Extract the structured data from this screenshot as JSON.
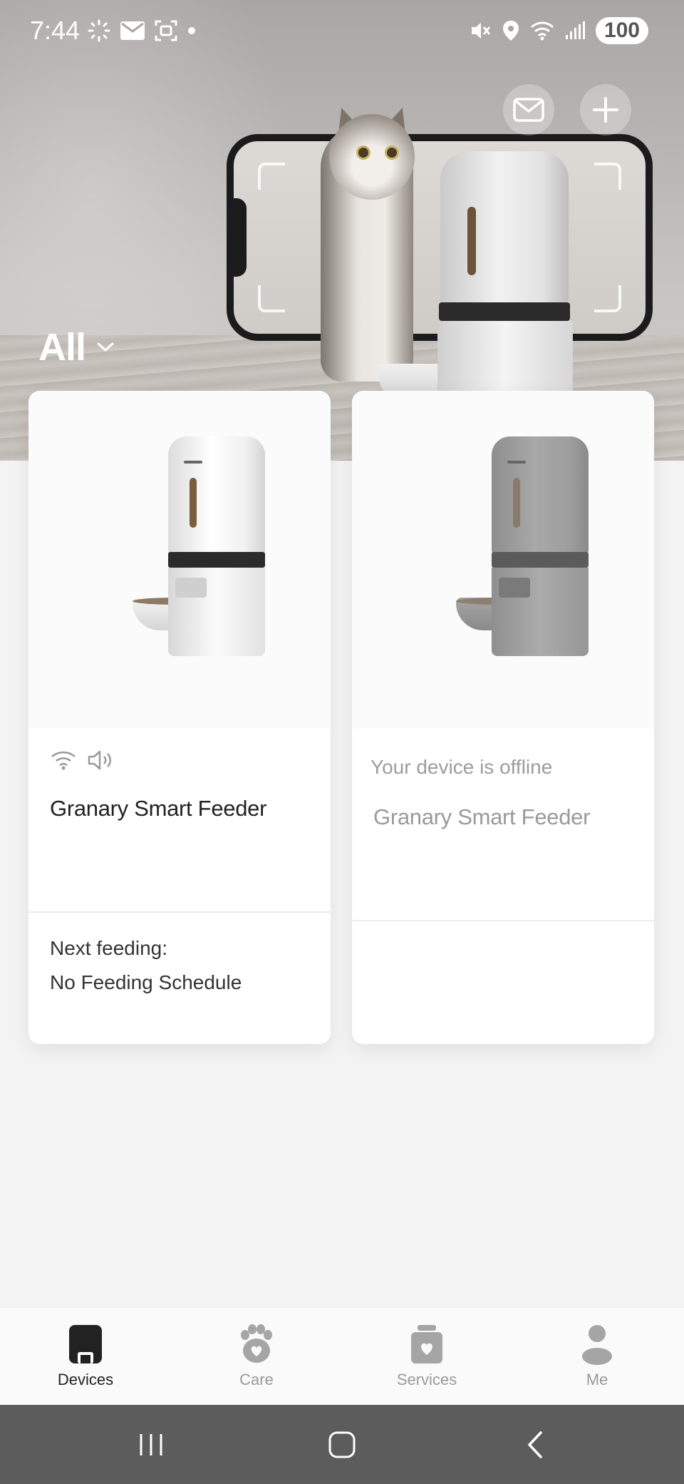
{
  "status_bar": {
    "time": "7:44",
    "battery": "100"
  },
  "header": {
    "filter_label": "All"
  },
  "devices": [
    {
      "name": "Granary Smart Feeder",
      "online": true,
      "next_feeding_label": "Next feeding:",
      "next_feeding_value": "No Feeding Schedule"
    },
    {
      "name": "Granary Smart Feeder",
      "online": false,
      "offline_message": "Your device is offline"
    }
  ],
  "tabbar": {
    "tabs": [
      {
        "label": "Devices",
        "icon": "devices-icon",
        "active": true
      },
      {
        "label": "Care",
        "icon": "paw-icon",
        "active": false
      },
      {
        "label": "Services",
        "icon": "services-icon",
        "active": false
      },
      {
        "label": "Me",
        "icon": "person-icon",
        "active": false
      }
    ]
  },
  "colors": {
    "background": "#f3f3f4",
    "active_tab": "#222222",
    "inactive_tab": "#9a9a9a",
    "system_nav": "#5c5c5c"
  }
}
